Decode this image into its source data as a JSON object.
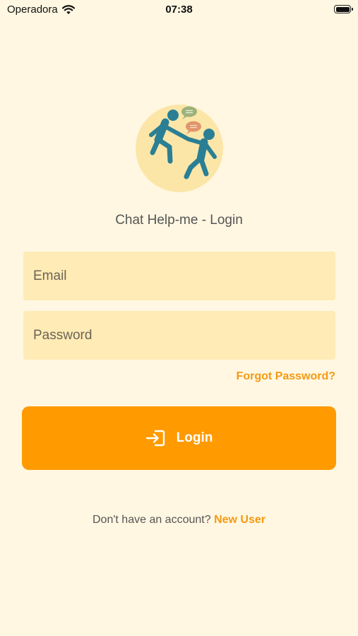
{
  "status_bar": {
    "carrier": "Operadora",
    "time": "07:38"
  },
  "app": {
    "title": "Chat Help-me - Login"
  },
  "form": {
    "email_placeholder": "Email",
    "password_placeholder": "Password",
    "forgot_password": "Forgot Password?",
    "login_label": "Login"
  },
  "signup": {
    "prompt": "Don't have an account?",
    "link": "New User"
  },
  "colors": {
    "background": "#fff7e2",
    "input_fill": "#ffebb5",
    "accent": "#ff9a00",
    "link": "#f49a12"
  },
  "icons": {
    "wifi": "wifi-icon",
    "battery": "battery-icon",
    "logo": "app-logo",
    "login": "login-icon"
  }
}
